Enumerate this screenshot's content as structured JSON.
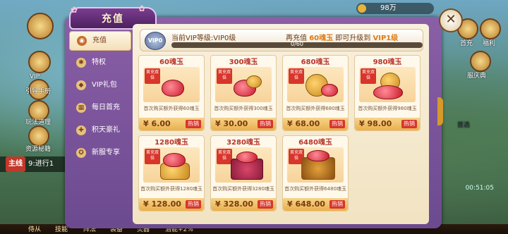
{
  "hud": {
    "left_labels": [
      "VIP",
      "引导手册",
      "玩法道理",
      "资源秘籍"
    ],
    "quest_tag": "主线",
    "quest_text": "9:进行1",
    "coin_value": "98万",
    "right_labels": [
      "首充",
      "福利",
      "服庆典",
      "首选"
    ],
    "timer": "00:51:05",
    "bottom_items": [
      "侍从",
      "技能",
      "阵法",
      "装备",
      "灵器",
      "潜能+2%"
    ]
  },
  "dialog": {
    "title": "充值",
    "close_label": "✕"
  },
  "sidenav": {
    "items": [
      {
        "label": "充值",
        "icon": "coin-bag-icon",
        "glyph": "◉",
        "active": true
      },
      {
        "label": "特权",
        "icon": "gear-icon",
        "glyph": "✱",
        "active": false
      },
      {
        "label": "VIP礼包",
        "icon": "diamond-icon",
        "glyph": "◆",
        "active": false
      },
      {
        "label": "每日首充",
        "icon": "calendar-icon",
        "glyph": "▦",
        "active": false
      },
      {
        "label": "积天豪礼",
        "icon": "gift-icon",
        "glyph": "✚",
        "active": false
      },
      {
        "label": "新服专享",
        "icon": "star-badge-icon",
        "glyph": "✪",
        "active": false
      }
    ]
  },
  "vip": {
    "badge": "VIP0",
    "status_text": "当前VIP等级:VIP0级",
    "next_prefix": "再充值",
    "next_amount": "60魂玉",
    "next_mid": "即可升级到",
    "next_level": "VIP1级",
    "progress_text": "0/60",
    "progress_fraction": 0
  },
  "products": [
    {
      "title": "60魂玉",
      "first_tag": "首充双倍",
      "desc": "首次购买额外获得60魂玉",
      "price": "¥ 6.00",
      "hot": "热销"
    },
    {
      "title": "300魂玉",
      "first_tag": "首充双倍",
      "desc": "首次购买额外获得300魂玉",
      "price": "¥ 30.00",
      "hot": "热销"
    },
    {
      "title": "680魂玉",
      "first_tag": "首充双倍",
      "desc": "首次购买额外获得680魂玉",
      "price": "¥ 68.00",
      "hot": "热销"
    },
    {
      "title": "980魂玉",
      "first_tag": "首充双倍",
      "desc": "首次购买额外获得980魂玉",
      "price": "¥ 98.00",
      "hot": "热销"
    },
    {
      "title": "1280魂玉",
      "first_tag": "首充双倍",
      "desc": "首次购买额外获得1280魂玉",
      "price": "¥ 128.00",
      "hot": "热销"
    },
    {
      "title": "3280魂玉",
      "first_tag": "首充双倍",
      "desc": "首次购买额外获得3280魂玉",
      "price": "¥ 328.00",
      "hot": "热销"
    },
    {
      "title": "6480魂玉",
      "first_tag": "首充双倍",
      "desc": "首次购买额外获得6480魂玉",
      "price": "¥ 648.00",
      "hot": "热销"
    }
  ]
}
